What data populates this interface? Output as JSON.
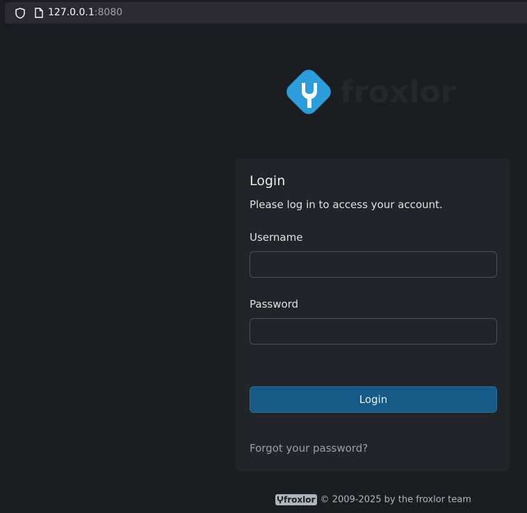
{
  "browser": {
    "url_host": "127.0.0.1",
    "url_port": ":8080"
  },
  "logo": {
    "name": "froxlor",
    "color": "#2d9cdb"
  },
  "login": {
    "title": "Login",
    "subtitle": "Please log in to access your account.",
    "username_label": "Username",
    "username_value": "",
    "password_label": "Password",
    "password_value": "",
    "submit_label": "Login",
    "forgot_link": "Forgot your password?"
  },
  "footer": {
    "badge": "froxlor",
    "copyright": "© 2009-2025 by",
    "team_link": "the froxlor team"
  },
  "colors": {
    "background": "#1b1e21",
    "card": "#212529",
    "primary_button": "#175a87"
  }
}
